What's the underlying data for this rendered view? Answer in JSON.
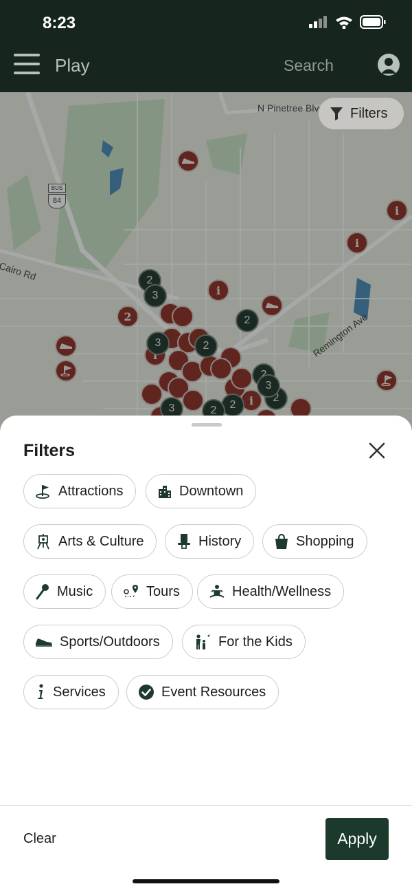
{
  "status": {
    "time": "8:23"
  },
  "header": {
    "title": "Play",
    "search_placeholder": "Search"
  },
  "map": {
    "filters_button": "Filters",
    "labels": {
      "street_pinetree": "N Pinetree Blvd",
      "street_cairo": "Cairo Rd",
      "street_remington": "Remington Ave",
      "route_bus": "BUS",
      "route_number": "84"
    },
    "clusters": [
      "2",
      "3",
      "2",
      "2",
      "3",
      "2",
      "2",
      "3",
      "2",
      "3",
      "2"
    ],
    "cluster_count_labels": [
      "2",
      "2"
    ]
  },
  "sheet": {
    "title": "Filters",
    "filters": [
      {
        "label": "Attractions",
        "icon": "golf-flag-icon"
      },
      {
        "label": "Downtown",
        "icon": "buildings-icon"
      },
      {
        "label": "Arts & Culture",
        "icon": "easel-icon"
      },
      {
        "label": "History",
        "icon": "top-hat-icon"
      },
      {
        "label": "Shopping",
        "icon": "shopping-bag-icon"
      },
      {
        "label": "Music",
        "icon": "microphone-icon"
      },
      {
        "label": "Tours",
        "icon": "map-pin-route-icon"
      },
      {
        "label": "Health/Wellness",
        "icon": "meditation-icon"
      },
      {
        "label": "Sports/Outdoors",
        "icon": "sneaker-icon"
      },
      {
        "label": "For the Kids",
        "icon": "family-icon"
      },
      {
        "label": "Services",
        "icon": "info-icon"
      },
      {
        "label": "Event Resources",
        "icon": "check-circle-icon"
      }
    ],
    "clear_label": "Clear",
    "apply_label": "Apply"
  },
  "colors": {
    "header_bg": "#16251d",
    "pin": "#8e2a24",
    "cluster": "#1d3128",
    "apply_bg": "#1b3a2c"
  }
}
